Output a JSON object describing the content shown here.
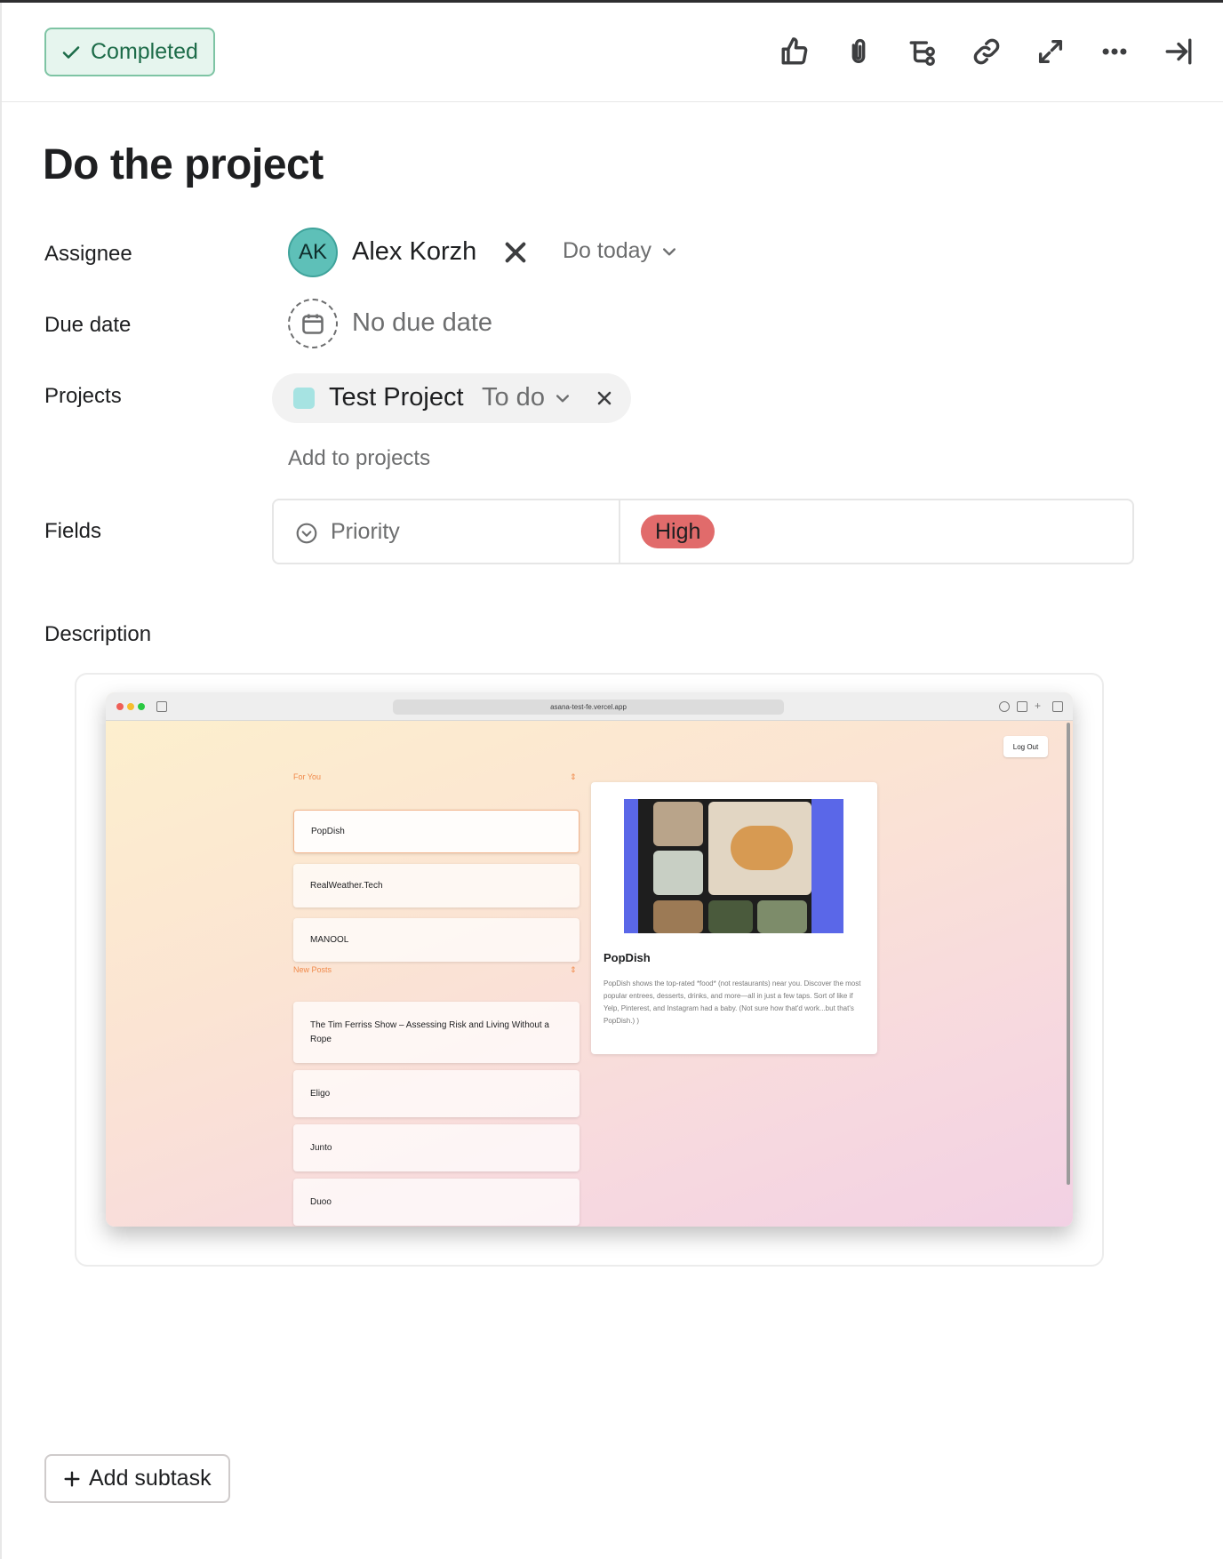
{
  "header": {
    "completed_label": "Completed",
    "actions": [
      "like-icon",
      "attach-icon",
      "subtask-icon",
      "link-icon",
      "expand-icon",
      "more-icon",
      "close-panel-icon"
    ]
  },
  "task": {
    "title": "Do the project"
  },
  "fields": {
    "assignee_label": "Assignee",
    "assignee_initials": "AK",
    "assignee_name": "Alex Korzh",
    "do_today": "Do today",
    "due_date_label": "Due date",
    "due_date_value": "No due date",
    "projects_label": "Projects",
    "project_name": "Test Project",
    "project_status": "To do",
    "add_to_projects": "Add to projects",
    "fields_label": "Fields",
    "priority_label": "Priority",
    "priority_value": "High",
    "description_label": "Description"
  },
  "colors": {
    "completed_bg": "#e6f5ee",
    "completed_border": "#7ec4a4",
    "avatar": "#5ec0b8",
    "project_swatch": "#a6e3e2",
    "priority_high": "#e16b6b"
  },
  "embedded": {
    "url": "asana-test-fe.vercel.app",
    "logout": "Log Out",
    "for_you_label": "For You",
    "for_you_items": [
      "PopDish",
      "RealWeather.Tech",
      "MANOOL"
    ],
    "new_posts_label": "New Posts",
    "new_posts_items": [
      "The Tim Ferriss Show – Assessing Risk and Living Without a Rope",
      "Eligo",
      "Junto",
      "Duoo"
    ],
    "detail_title": "PopDish",
    "detail_desc": "PopDish shows the top-rated *food* (not restaurants) near you. Discover the most popular entrees, desserts, drinks, and more—all in just a few taps. Sort of like if Yelp, Pinterest, and Instagram had a baby. (Not sure how that'd work...but that's PopDish.) )"
  },
  "footer": {
    "add_subtask": "Add subtask"
  }
}
